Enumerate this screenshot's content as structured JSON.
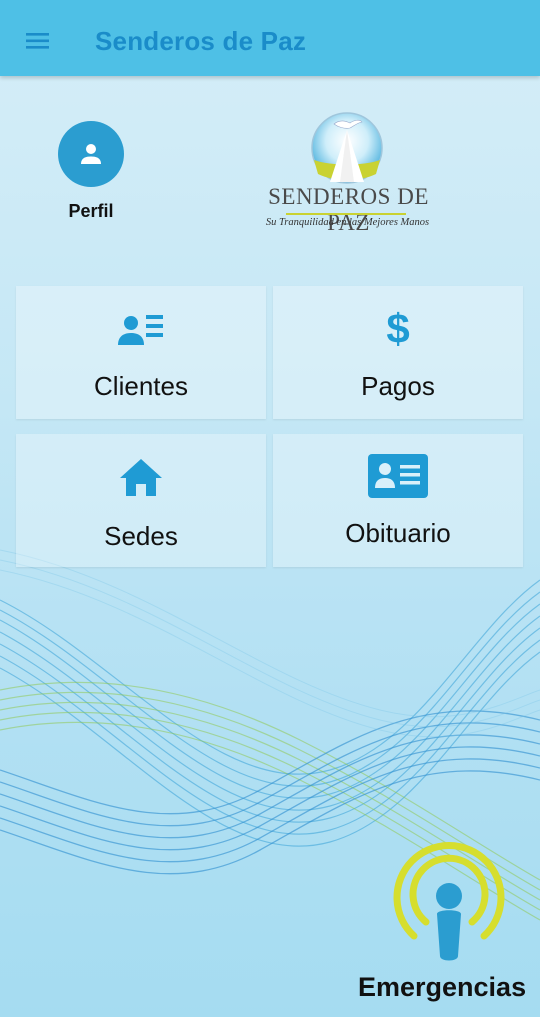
{
  "app": {
    "title": "Senderos de Paz",
    "accent": "#4ec0e6",
    "title_color": "#1a8cc9",
    "menu_icon": "menu-icon"
  },
  "profile": {
    "label": "Perfil",
    "icon": "person-icon"
  },
  "logo": {
    "name": "SENDEROS DE PAZ",
    "tagline": "Su Tranquilidad en las Mejores Manos"
  },
  "tiles": [
    {
      "label": "Clientes",
      "icon": "contacts-list-icon"
    },
    {
      "label": "Pagos",
      "icon": "dollar-icon"
    },
    {
      "label": "Sedes",
      "icon": "home-icon"
    },
    {
      "label": "Obituario",
      "icon": "id-card-icon"
    }
  ],
  "emergency": {
    "label": "Emergencias",
    "icon": "broadcast-person-icon",
    "ring_color": "#d6de2e",
    "figure_color": "#2b9dd0"
  }
}
